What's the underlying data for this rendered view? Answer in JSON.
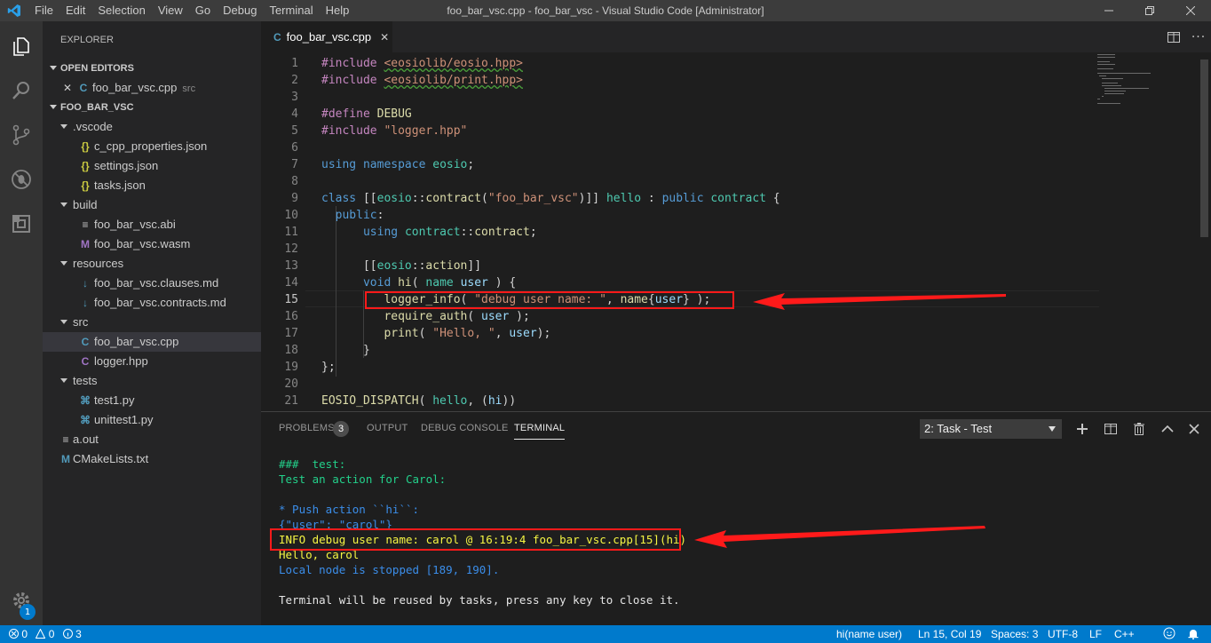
{
  "window": {
    "title": "foo_bar_vsc.cpp - foo_bar_vsc - Visual Studio Code [Administrator]",
    "menu": [
      "File",
      "Edit",
      "Selection",
      "View",
      "Go",
      "Debug",
      "Terminal",
      "Help"
    ]
  },
  "activity_bar": {
    "items": [
      "files-icon",
      "search-icon",
      "source-control-icon",
      "debug-icon",
      "extensions-icon"
    ],
    "settings_badge": "1"
  },
  "sidebar": {
    "title": "EXPLORER",
    "open_editors_label": "OPEN EDITORS",
    "open_editor": {
      "close": "✕",
      "icon": "C",
      "name": "foo_bar_vsc.cpp",
      "folder": "src"
    },
    "project_label": "FOO_BAR_VSC",
    "tree": [
      {
        "label": ".vscode",
        "icon": "",
        "kind": "folder"
      },
      {
        "label": "c_cpp_properties.json",
        "icon": "{}",
        "kind": "json"
      },
      {
        "label": "settings.json",
        "icon": "{}",
        "kind": "json"
      },
      {
        "label": "tasks.json",
        "icon": "{}",
        "kind": "json"
      },
      {
        "label": "build",
        "icon": "",
        "kind": "folder"
      },
      {
        "label": "foo_bar_vsc.abi",
        "icon": "≡",
        "kind": "text"
      },
      {
        "label": "foo_bar_vsc.wasm",
        "icon": "M",
        "kind": "wasm"
      },
      {
        "label": "resources",
        "icon": "",
        "kind": "folder"
      },
      {
        "label": "foo_bar_vsc.clauses.md",
        "icon": "↓",
        "kind": "md"
      },
      {
        "label": "foo_bar_vsc.contracts.md",
        "icon": "↓",
        "kind": "md"
      },
      {
        "label": "src",
        "icon": "",
        "kind": "folder"
      },
      {
        "label": "foo_bar_vsc.cpp",
        "icon": "C",
        "kind": "cpp"
      },
      {
        "label": "logger.hpp",
        "icon": "C",
        "kind": "hpp"
      },
      {
        "label": "tests",
        "icon": "",
        "kind": "folder"
      },
      {
        "label": "test1.py",
        "icon": "⌘",
        "kind": "py"
      },
      {
        "label": "unittest1.py",
        "icon": "⌘",
        "kind": "py"
      },
      {
        "label": "a.out",
        "icon": "≡",
        "kind": "text"
      },
      {
        "label": "CMakeLists.txt",
        "icon": "M",
        "kind": "cmake"
      }
    ]
  },
  "editor": {
    "tab": {
      "icon": "C",
      "name": "foo_bar_vsc.cpp",
      "close": "✕"
    },
    "current_line": 15,
    "lines": [
      [
        [
          "pp",
          "#include "
        ],
        [
          "str",
          "<eosiolib/eosio.hpp>"
        ]
      ],
      [
        [
          "pp",
          "#include "
        ],
        [
          "str",
          "<eosiolib/print.hpp>"
        ]
      ],
      [],
      [
        [
          "pp",
          "#define "
        ],
        [
          "fn",
          "DEBUG"
        ]
      ],
      [
        [
          "pp",
          "#include "
        ],
        [
          "str",
          "\"logger.hpp\""
        ]
      ],
      [],
      [
        [
          "kw",
          "using "
        ],
        [
          "kw",
          "namespace "
        ],
        [
          "tp",
          "eosio"
        ],
        [
          "p",
          ";"
        ]
      ],
      [],
      [
        [
          "kw",
          "class "
        ],
        [
          "p",
          "[["
        ],
        [
          "tp",
          "eosio"
        ],
        [
          "p",
          "::"
        ],
        [
          "fn",
          "contract"
        ],
        [
          "p",
          "("
        ],
        [
          "str",
          "\"foo_bar_vsc\""
        ],
        [
          "p",
          ")]] "
        ],
        [
          "tp",
          "hello"
        ],
        [
          "p",
          " : "
        ],
        [
          "kw",
          "public "
        ],
        [
          "tp",
          "contract"
        ],
        [
          "p",
          " {"
        ]
      ],
      [
        [
          "p",
          "  "
        ],
        [
          "kw",
          "public"
        ],
        [
          "p",
          ":"
        ]
      ],
      [
        [
          "p",
          "      "
        ],
        [
          "kw",
          "using "
        ],
        [
          "tp",
          "contract"
        ],
        [
          "p",
          "::"
        ],
        [
          "fn",
          "contract"
        ],
        [
          "p",
          ";"
        ]
      ],
      [],
      [
        [
          "p",
          "      [["
        ],
        [
          "tp",
          "eosio"
        ],
        [
          "p",
          "::"
        ],
        [
          "fn",
          "action"
        ],
        [
          "p",
          "]]"
        ]
      ],
      [
        [
          "p",
          "      "
        ],
        [
          "kw",
          "void "
        ],
        [
          "fn",
          "hi"
        ],
        [
          "p",
          "( "
        ],
        [
          "tp",
          "name "
        ],
        [
          "var",
          "user"
        ],
        [
          "p",
          " ) {"
        ]
      ],
      [
        [
          "p",
          "         "
        ],
        [
          "fn",
          "logger_info"
        ],
        [
          "p",
          "( "
        ],
        [
          "str",
          "\"debug user name: \""
        ],
        [
          "p",
          ", "
        ],
        [
          "fn",
          "name"
        ],
        [
          "p",
          "{"
        ],
        [
          "var",
          "user"
        ],
        [
          "p",
          "} );"
        ]
      ],
      [
        [
          "p",
          "         "
        ],
        [
          "fn",
          "require_auth"
        ],
        [
          "p",
          "( "
        ],
        [
          "var",
          "user"
        ],
        [
          "p",
          " );"
        ]
      ],
      [
        [
          "p",
          "         "
        ],
        [
          "fn",
          "print"
        ],
        [
          "p",
          "( "
        ],
        [
          "str",
          "\"Hello, \""
        ],
        [
          "p",
          ", "
        ],
        [
          "var",
          "user"
        ],
        [
          "p",
          ");"
        ]
      ],
      [
        [
          "p",
          "      }"
        ]
      ],
      [
        [
          "p",
          "};"
        ]
      ],
      [],
      [
        [
          "fn",
          "EOSIO_DISPATCH"
        ],
        [
          "p",
          "( "
        ],
        [
          "tp",
          "hello"
        ],
        [
          "p",
          ", ("
        ],
        [
          "var",
          "hi"
        ],
        [
          "p",
          "))"
        ]
      ]
    ]
  },
  "panel": {
    "tabs": [
      "PROBLEMS",
      "OUTPUT",
      "DEBUG CONSOLE",
      "TERMINAL"
    ],
    "problems_count": "3",
    "active_tab": "TERMINAL",
    "terminal_select": "2: Task - Test",
    "actions": [
      "plus-icon",
      "split-icon",
      "trash-icon",
      "chevron-up-icon",
      "close-icon"
    ],
    "terminal_lines": [
      {
        "text": "###  test:",
        "color": "green"
      },
      {
        "text": "Test an action for Carol:",
        "color": "green"
      },
      {
        "text": "",
        "color": "white"
      },
      {
        "text": "* Push action ``hi``:",
        "color": "blue"
      },
      {
        "text": "{\"user\": \"carol\"}",
        "color": "blue"
      },
      {
        "text": "INFO debug user name: carol @ 16:19:4 foo_bar_vsc.cpp[15](hi)",
        "color": "yellow"
      },
      {
        "text": "Hello, carol",
        "color": "yellow"
      },
      {
        "text": "Local node is stopped [189, 190].",
        "color": "blue"
      },
      {
        "text": "",
        "color": "white"
      },
      {
        "text": "Terminal will be reused by tasks, press any key to close it.",
        "color": "white"
      }
    ]
  },
  "status_bar": {
    "errors": "0",
    "warnings": "0",
    "info": "3",
    "function": "hi(name user)",
    "position": "Ln 15, Col 19",
    "spaces": "Spaces: 3",
    "encoding": "UTF-8",
    "eol": "LF",
    "language": "C++"
  },
  "colors": {
    "accent": "#007acc",
    "annotation": "#ff1a1a",
    "terminal_green": "#23d18b",
    "terminal_blue": "#3b8eea",
    "terminal_yellow": "#f5f543"
  }
}
